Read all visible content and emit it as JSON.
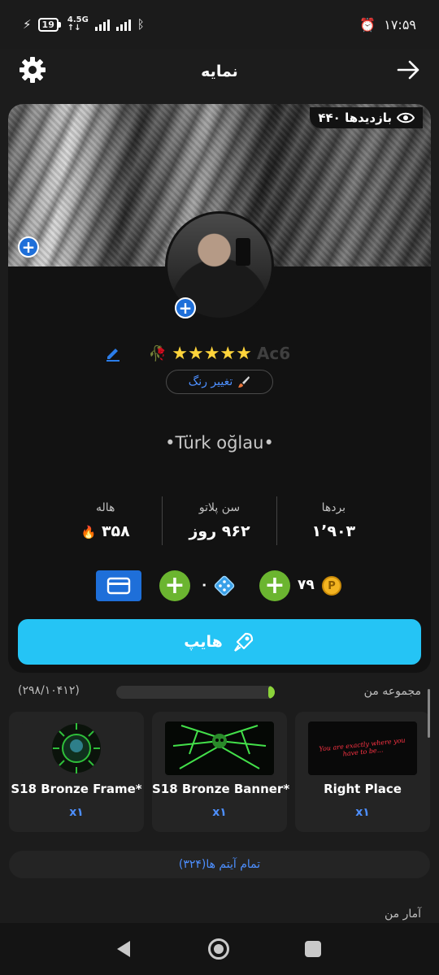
{
  "status_bar": {
    "battery": "19",
    "network": "4.5G",
    "time": "۱۷:۵۹"
  },
  "header": {
    "title": "نمایه"
  },
  "profile": {
    "views": "۴۴۰ بازدیدها",
    "stars": "★★★★★",
    "flower": "🥀",
    "username_ghost": "Ac6",
    "change_color_label": "تغییر رنگ",
    "bio": "•Türk oğlau•",
    "stats": [
      {
        "label": "بردها",
        "value": "۱٬۹۰۳"
      },
      {
        "label": "سن پلاتو",
        "value": "۹۶۲ روز"
      },
      {
        "label": "هاله",
        "value": "۳۵۸"
      }
    ],
    "coins": "۷۹",
    "dice": "۰",
    "hype_label": "هایپ"
  },
  "collection": {
    "title": "مجموعه من",
    "progress_text": "(۲۹۸/۱۰۴۱۲)",
    "progress_fraction": 0.029,
    "items": [
      {
        "name": "Right Place",
        "count": "x۱"
      },
      {
        "name": "S18 Bronze Banner*",
        "count": "x۱"
      },
      {
        "name": "S18 Bronze Frame*",
        "count": "x۱"
      }
    ],
    "right_place_art_text": "You are exactly where you have to be...",
    "all_items_label": "تمام آیتم ها(۳۲۴)"
  },
  "my_stats_title": "آمار من",
  "colors": {
    "accent_blue": "#1e6fd9",
    "hype_cyan": "#25c4f5",
    "green": "#6bb530",
    "progress_green": "#8bd33a"
  }
}
